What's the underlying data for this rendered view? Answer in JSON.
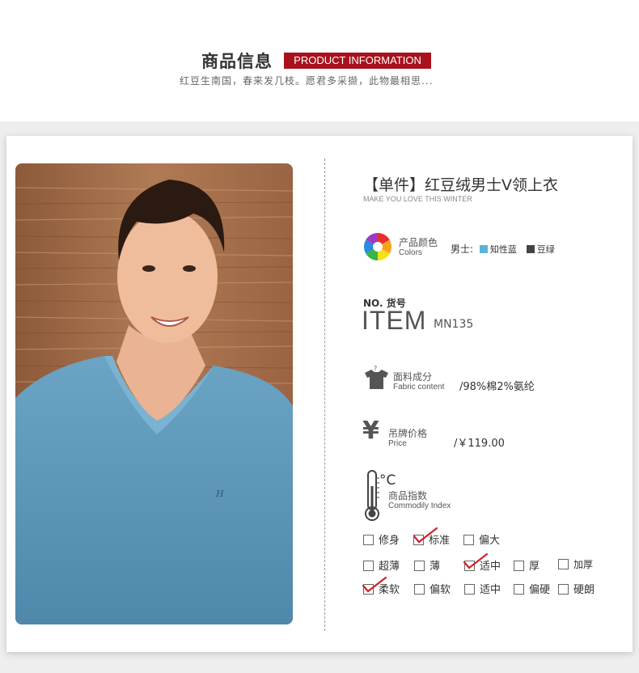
{
  "header": {
    "title_cn": "商品信息",
    "title_en": "PRODUCT INFORMATION",
    "subtitle": "红豆生南国，春来发几枝。愿君多采撷，此物最相思..."
  },
  "product": {
    "title": "【单件】红豆绒男士V领上衣",
    "subtitle": "MAKE YOU LOVE THIS WINTER"
  },
  "colors": {
    "label_cn": "产品颜色",
    "label_en": "Colors",
    "prefix": "男士:",
    "options": [
      {
        "name": "知性蓝",
        "color": "#5ab4d8"
      },
      {
        "name": "豆绿",
        "color": "#444444"
      }
    ]
  },
  "item": {
    "label_no": "NO. 货号",
    "label_big": "ITEM",
    "value": "MN135"
  },
  "fabric": {
    "label_cn": "面料成分",
    "label_en": "Fabric content",
    "value": "/98%棉2%氨纶"
  },
  "price": {
    "label_cn": "吊牌价格",
    "label_en": "Price",
    "value": "/￥119.00"
  },
  "index": {
    "unit": "°C",
    "label_cn": "商品指数",
    "label_en": "Commodily Index",
    "rows": [
      [
        {
          "label": "修身",
          "checked": false
        },
        {
          "label": "标准",
          "checked": true
        },
        {
          "label": "偏大",
          "checked": false
        }
      ],
      [
        {
          "label": "超薄",
          "checked": false
        },
        {
          "label": "薄",
          "checked": false
        },
        {
          "label": "适中",
          "checked": true
        },
        {
          "label": "厚",
          "checked": false
        },
        {
          "label": "加厚",
          "checked": false
        }
      ],
      [
        {
          "label": "柔软",
          "checked": true
        },
        {
          "label": "偏软",
          "checked": false
        },
        {
          "label": "适中",
          "checked": false
        },
        {
          "label": "偏硬",
          "checked": false
        },
        {
          "label": "硬朗",
          "checked": false
        }
      ]
    ]
  },
  "theme": {
    "accent": "#a8121c",
    "check_color": "#d0202a"
  }
}
